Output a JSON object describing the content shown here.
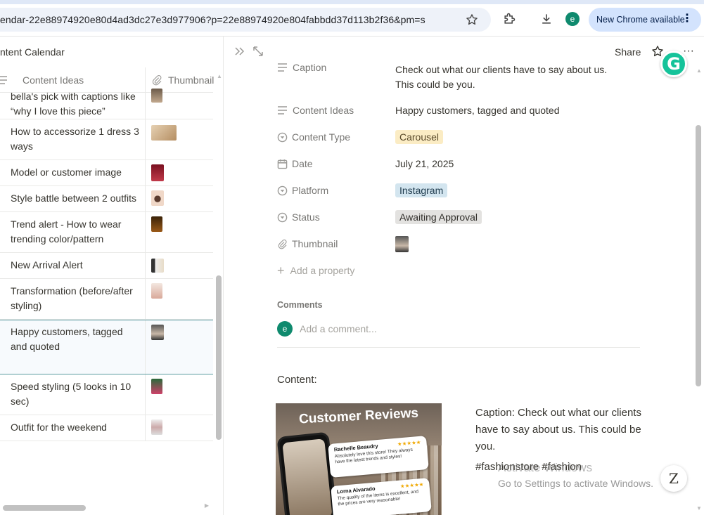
{
  "browser": {
    "url": "endar-22e88974920e80d4ad3dc27e3d977906?p=22e88974920e804fabbdd37d113b2f36&pm=s",
    "profile_initial": "e",
    "new_chrome_label": "New Chrome available"
  },
  "left": {
    "title": "ntent Calendar",
    "columns": [
      "Content Ideas",
      "Thumbnail"
    ],
    "rows": [
      {
        "text": "bella's pick with captions like “why I love this piece”"
      },
      {
        "text": "How to accessorize 1 dress 3 ways"
      },
      {
        "text": "Model or customer image"
      },
      {
        "text": "Style battle between 2 outfits"
      },
      {
        "text": "Trend alert - How to wear trending color/pattern"
      },
      {
        "text": " New Arrival Alert"
      },
      {
        "text": " Transformation (before/after styling)"
      },
      {
        "text": "Happy customers, tagged and quoted"
      },
      {
        "text": "Speed styling (5 looks in 10 sec)"
      },
      {
        "text": "Outfit for the weekend"
      }
    ]
  },
  "right": {
    "share_label": "Share",
    "properties": {
      "caption_label": "Caption",
      "caption_value": "Check out what our clients have to say about us. This could be you.",
      "content_ideas_label": "Content Ideas",
      "content_ideas_value": "Happy customers, tagged and quoted",
      "content_type_label": "Content Type",
      "content_type_value": "Carousel",
      "date_label": "Date",
      "date_value": "July 21, 2025",
      "platform_label": "Platform",
      "platform_value": "Instagram",
      "status_label": "Status",
      "status_value": "Awaiting Approval",
      "thumbnail_label": "Thumbnail"
    },
    "add_property": "Add a property",
    "comments_heading": "Comments",
    "comment_avatar": "e",
    "comment_placeholder": "Add a comment...",
    "content_heading": "Content:",
    "image": {
      "title": "Customer Reviews",
      "review1_name": "Rachelle Beaudry",
      "review1_stars": "★★★★★",
      "review1_text": "Absolutely love this store! They always have the latest trends and styles!",
      "review2_name": "Lorna Alvarado",
      "review2_stars": "★★★★★",
      "review2_text": "The quality of the items is excellent, and the prices are very reasonable!"
    },
    "caption_text": "Caption: Check out what our clients have to say about us. This could be you.",
    "hashtags": "#fashionstore #fashion",
    "activate_title": "Activate Windows",
    "activate_sub": "Go to Settings to activate Windows."
  },
  "colors": {
    "carousel_tag_bg": "#fbecc4",
    "instagram_tag_bg": "#d3e5ef",
    "status_tag_bg": "#e3e2e0",
    "selected_row_border": "#5b9ba0",
    "avatar": "#0f8a6e",
    "grammarly": "#15c39a"
  },
  "icons": [
    "star-icon",
    "extensions-icon",
    "download-icon",
    "more-vert-icon",
    "collapse-panel-icon",
    "expand-icon",
    "text-lines-icon",
    "select-circle-icon",
    "calendar-icon",
    "paperclip-icon",
    "plus-icon",
    "grammarly-icon"
  ]
}
